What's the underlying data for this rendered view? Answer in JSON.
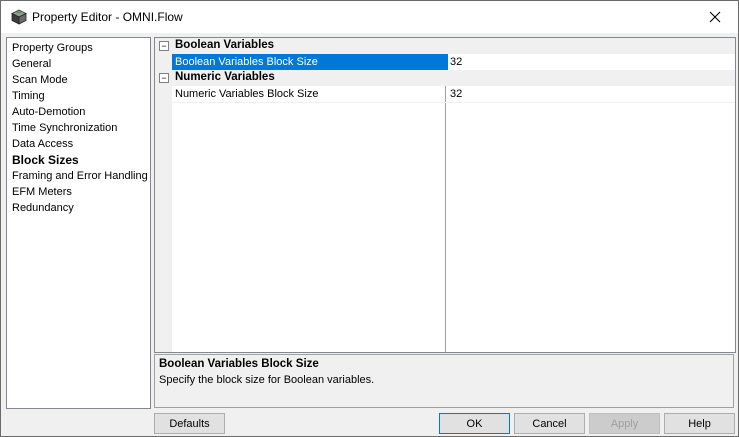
{
  "window": {
    "title": "Property Editor - OMNI.Flow",
    "icon": "cube-app-icon"
  },
  "groups": {
    "header": "Property Groups",
    "items": [
      {
        "label": "General"
      },
      {
        "label": "Scan Mode"
      },
      {
        "label": "Timing"
      },
      {
        "label": "Auto-Demotion"
      },
      {
        "label": "Time Synchronization"
      },
      {
        "label": "Data Access"
      },
      {
        "label": "Block Sizes",
        "selected": true
      },
      {
        "label": "Framing and Error Handling"
      },
      {
        "label": "EFM Meters"
      },
      {
        "label": "Redundancy"
      }
    ]
  },
  "grid": {
    "categories": [
      {
        "label": "Boolean Variables",
        "toggle": "−",
        "properties": [
          {
            "name": "Boolean Variables Block Size",
            "value": "32",
            "selected": true
          }
        ]
      },
      {
        "label": "Numeric Variables",
        "toggle": "−",
        "properties": [
          {
            "name": "Numeric Variables Block Size",
            "value": "32",
            "selected": false
          }
        ]
      }
    ]
  },
  "description": {
    "title": "Boolean Variables Block Size",
    "text": "Specify the block size for Boolean variables."
  },
  "buttons": {
    "defaults": "Defaults",
    "ok": "OK",
    "cancel": "Cancel",
    "apply": "Apply",
    "help": "Help"
  },
  "colors": {
    "selection": "#0078d7",
    "window_bg": "#f0f0f0",
    "panel_bg": "#ffffff"
  }
}
